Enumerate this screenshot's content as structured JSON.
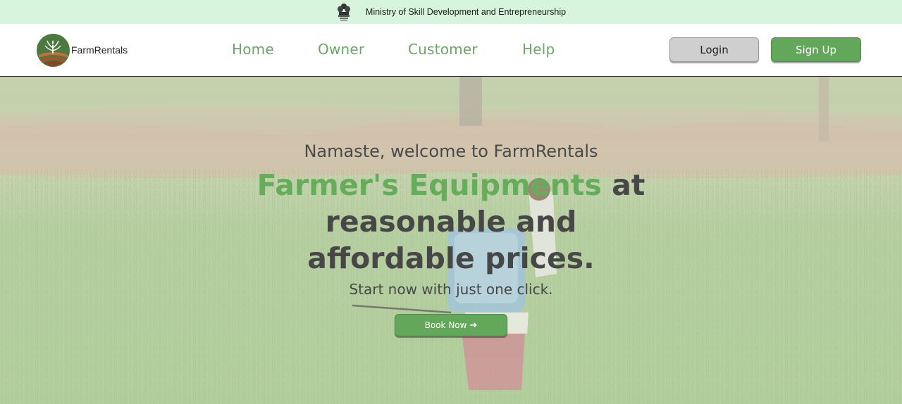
{
  "gov_banner": {
    "text": "Ministry of Skill Development and Entrepreneurship",
    "emblem_icon": "national-emblem-icon"
  },
  "header": {
    "brand_name": "FarmRentals",
    "logo_icon": "farm-plant-logo-icon",
    "nav": [
      {
        "label": "Home"
      },
      {
        "label": "Owner"
      },
      {
        "label": "Customer"
      },
      {
        "label": "Help"
      }
    ],
    "login_label": "Login",
    "signup_label": "Sign Up"
  },
  "hero": {
    "welcome": "Namaste, welcome to FarmRentals",
    "headline_green": "Farmer's Equipments",
    "headline_rest": " at reasonable and affordable prices.",
    "subtitle": "Start now with just one click.",
    "book_label": "Book Now",
    "book_icon": "arrow-right-icon"
  },
  "colors": {
    "accent_green": "#63a85a",
    "banner_bg": "#d7f5dc",
    "heading_text": "#474747"
  }
}
